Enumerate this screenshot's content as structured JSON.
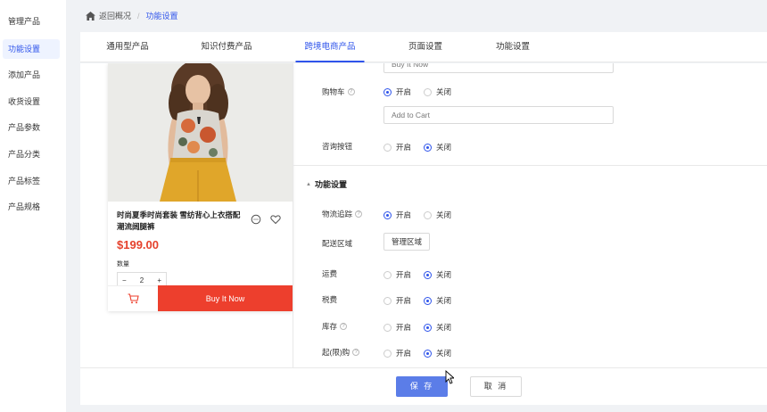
{
  "sidebar": {
    "items": [
      {
        "label": "管理产品"
      },
      {
        "label": "功能设置",
        "active": true
      },
      {
        "label": "添加产品"
      },
      {
        "label": "收货设置"
      },
      {
        "label": "产品参数"
      },
      {
        "label": "产品分类"
      },
      {
        "label": "产品标签"
      },
      {
        "label": "产品规格"
      }
    ]
  },
  "breadcrumb": {
    "home_icon": "home-icon",
    "back": "返回概况",
    "separator": "/",
    "current": "功能设置"
  },
  "tabs": [
    {
      "label": "通用型产品"
    },
    {
      "label": "知识付费产品"
    },
    {
      "label": "跨境电商产品",
      "active": true
    },
    {
      "label": "页面设置"
    },
    {
      "label": "功能设置"
    }
  ],
  "preview": {
    "title": "时尚夏季时尚套装 雪纺背心上衣搭配潮流阔腿裤",
    "price": "$199.00",
    "quantity_label": "数量",
    "quantity": "2",
    "minus": "−",
    "plus": "+",
    "buy_button": "Buy It Now",
    "accent_color": "#ed3f2d"
  },
  "settings": {
    "buy_button_input": "Buy It Now",
    "cart": {
      "label": "购物车",
      "options": [
        "开启",
        "关闭"
      ],
      "selected": "开启",
      "input_value": "Add to Cart"
    },
    "consult": {
      "label": "咨询按钮",
      "options": [
        "开启",
        "关闭"
      ],
      "selected": "关闭"
    },
    "section_title": "功能设置",
    "tracking": {
      "label": "物流追踪",
      "options": [
        "开启",
        "关闭"
      ],
      "selected": "开启"
    },
    "delivery": {
      "label": "配送区域",
      "button": "管理区域"
    },
    "shipping": {
      "label": "运费",
      "options": [
        "开启",
        "关闭"
      ],
      "selected": "关闭"
    },
    "tax": {
      "label": "税费",
      "options": [
        "开启",
        "关闭"
      ],
      "selected": "关闭"
    },
    "stock": {
      "label": "库存",
      "options": [
        "开启",
        "关闭"
      ],
      "selected": "关闭"
    },
    "limit": {
      "label": "起(限)购",
      "options": [
        "开启",
        "关闭"
      ],
      "selected": "关闭"
    }
  },
  "footer": {
    "save": "保 存",
    "cancel": "取 消"
  },
  "colors": {
    "primary": "#2f54eb",
    "save_button": "#5b7de8"
  }
}
